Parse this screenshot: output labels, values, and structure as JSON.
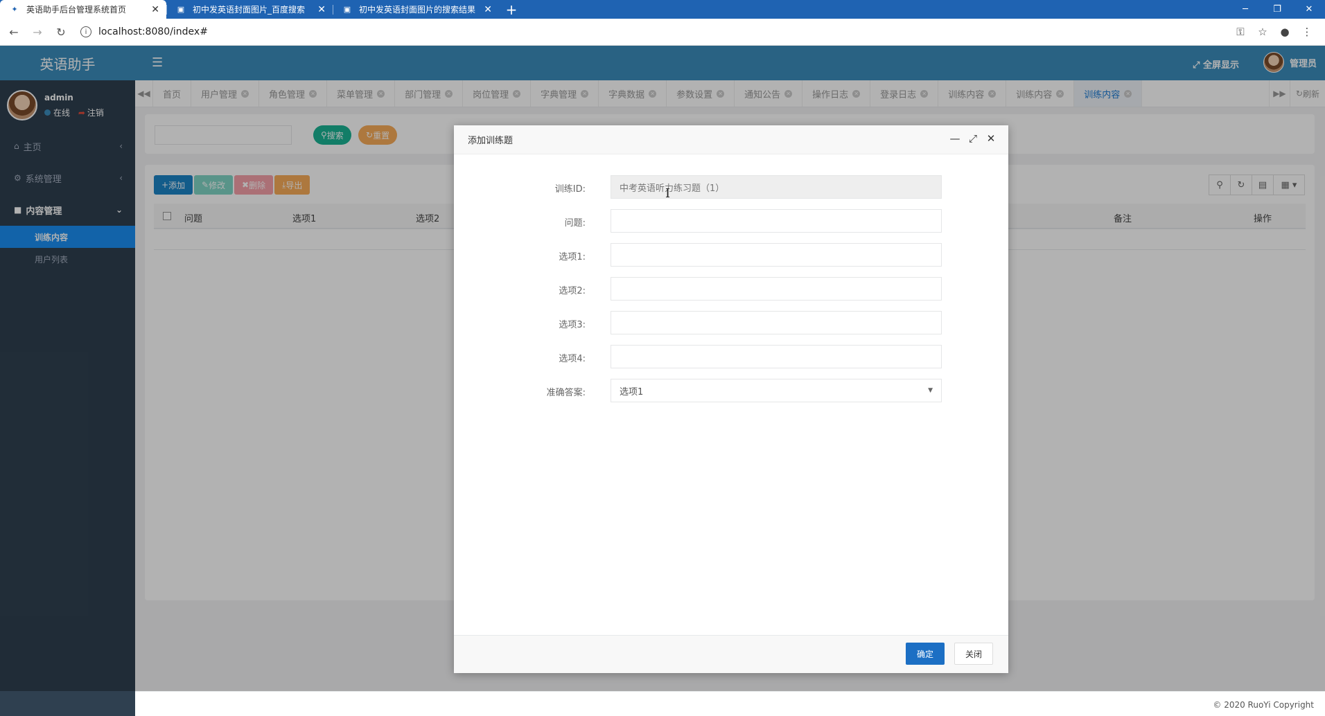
{
  "browser": {
    "tabs": [
      {
        "title": "英语助手后台管理系统首页",
        "active": true
      },
      {
        "title": "初中发英语封面图片_百度搜索",
        "active": false
      },
      {
        "title": "初中发英语封面图片的搜索结果",
        "active": false
      }
    ],
    "new_tab": "+",
    "url": "localhost:8080/index#"
  },
  "sidebar": {
    "brand": "英语助手",
    "user": {
      "name": "admin",
      "status": "在线",
      "logout": "注销"
    },
    "menu": [
      {
        "label": "主页",
        "icon": "home-icon",
        "caret": "‹"
      },
      {
        "label": "系统管理",
        "icon": "gear-icon",
        "caret": "‹"
      },
      {
        "label": "内容管理",
        "icon": "briefcase-icon",
        "caret": "⌄"
      }
    ],
    "submenu": [
      {
        "label": "训练内容",
        "active": true
      },
      {
        "label": "用户列表",
        "active": false
      }
    ]
  },
  "topbar": {
    "fullscreen": "全屏显示",
    "admin": "管理员"
  },
  "page_tabs": {
    "items": [
      {
        "label": "首页",
        "closable": false
      },
      {
        "label": "用户管理",
        "closable": true
      },
      {
        "label": "角色管理",
        "closable": true
      },
      {
        "label": "菜单管理",
        "closable": true
      },
      {
        "label": "部门管理",
        "closable": true
      },
      {
        "label": "岗位管理",
        "closable": true
      },
      {
        "label": "字典管理",
        "closable": true
      },
      {
        "label": "字典数据",
        "closable": true
      },
      {
        "label": "参数设置",
        "closable": true
      },
      {
        "label": "通知公告",
        "closable": true
      },
      {
        "label": "操作日志",
        "closable": true
      },
      {
        "label": "登录日志",
        "closable": true
      },
      {
        "label": "训练内容",
        "closable": true
      },
      {
        "label": "训练内容",
        "closable": true
      },
      {
        "label": "训练内容",
        "closable": true,
        "active": true
      }
    ],
    "refresh": "刷新"
  },
  "search": {
    "search_button": "搜索",
    "reset_button": "重置"
  },
  "toolbar": {
    "add": "添加",
    "edit": "修改",
    "delete": "删除",
    "export": "导出"
  },
  "table": {
    "columns": [
      "问题",
      "选项1",
      "选项2",
      "备注",
      "操作"
    ]
  },
  "dialog": {
    "title": "添加训练题",
    "fields": [
      {
        "label": "训练ID:",
        "value": "中考英语听力练习题（1）",
        "readonly": true
      },
      {
        "label": "问题:",
        "value": ""
      },
      {
        "label": "选项1:",
        "value": ""
      },
      {
        "label": "选项2:",
        "value": ""
      },
      {
        "label": "选项3:",
        "value": ""
      },
      {
        "label": "选项4:",
        "value": ""
      }
    ],
    "answer": {
      "label": "准确答案:",
      "selected": "选项1"
    },
    "ok_button": "确定",
    "close_button": "关闭"
  },
  "footer": {
    "copyright": "© 2020 RuoYi Copyright"
  },
  "colors": {
    "brand": "#3c8dbc",
    "sidebar": "#2f4050",
    "primary": "#1c84c6",
    "success": "#1ab394",
    "danger": "#ed5565",
    "warning": "#f8ac59"
  }
}
